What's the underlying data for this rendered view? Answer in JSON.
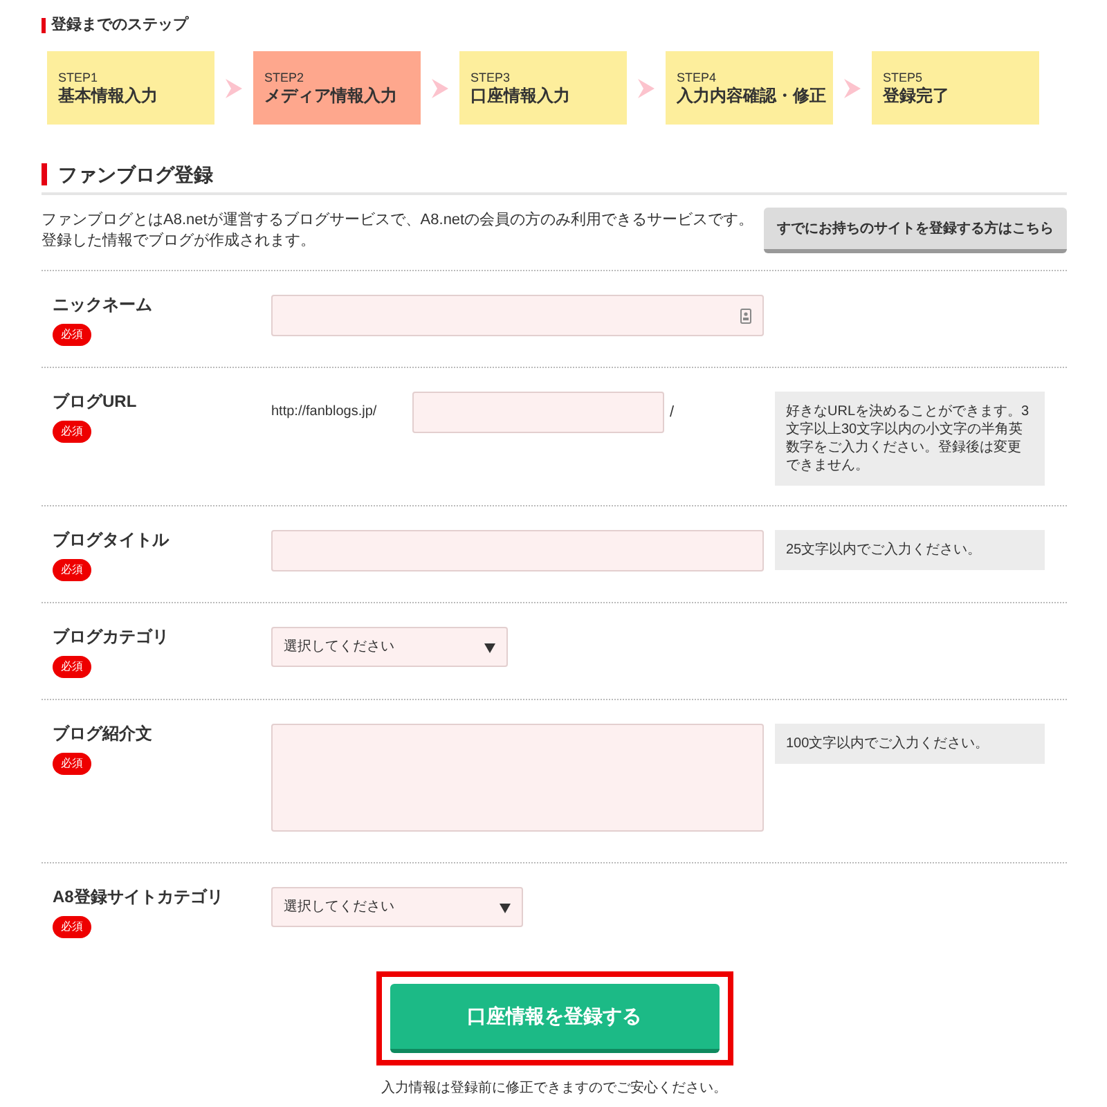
{
  "steps_heading": "登録までのステップ",
  "steps": [
    {
      "step": "STEP1",
      "label": "基本情報入力",
      "selected": false
    },
    {
      "step": "STEP2",
      "label": "メディア情報入力",
      "selected": true
    },
    {
      "step": "STEP3",
      "label": "口座情報入力",
      "selected": false
    },
    {
      "step": "STEP4",
      "label": "入力内容確認・修正",
      "selected": false
    },
    {
      "step": "STEP5",
      "label": "登録完了",
      "selected": false
    }
  ],
  "section_title": "ファンブログ登録",
  "description": "ファンブログとはA8.netが運営するブログサービスで、A8.netの会員の方のみ利用できるサービスです。登録した情報でブログが作成されます。",
  "existing_site_button": "すでにお持ちのサイトを登録する方はこちら",
  "fields": [
    {
      "kind": "text",
      "label": "ニックネーム",
      "required": "必須"
    },
    {
      "kind": "url",
      "label": "ブログURL",
      "required": "必須",
      "prefix": "http://fanblogs.jp/",
      "suffix": "/",
      "hint": "好きなURLを決めることができます。3文字以上30文字以内の小文字の半角英数字をご入力ください。登録後は変更できません。"
    },
    {
      "kind": "text",
      "label": "ブログタイトル",
      "required": "必須",
      "hint": "25文字以内でご入力ください。"
    },
    {
      "kind": "select",
      "label": "ブログカテゴリ",
      "required": "必須",
      "value": "選択してください"
    },
    {
      "kind": "textarea",
      "label": "ブログ紹介文",
      "required": "必須",
      "hint": "100文字以内でご入力ください。"
    },
    {
      "kind": "select",
      "label": "A8登録サイトカテゴリ",
      "required": "必須",
      "value": "選択してください"
    }
  ],
  "submit_button": "口座情報を登録する",
  "note": "入力情報は登録前に修正できますのでご安心ください。"
}
